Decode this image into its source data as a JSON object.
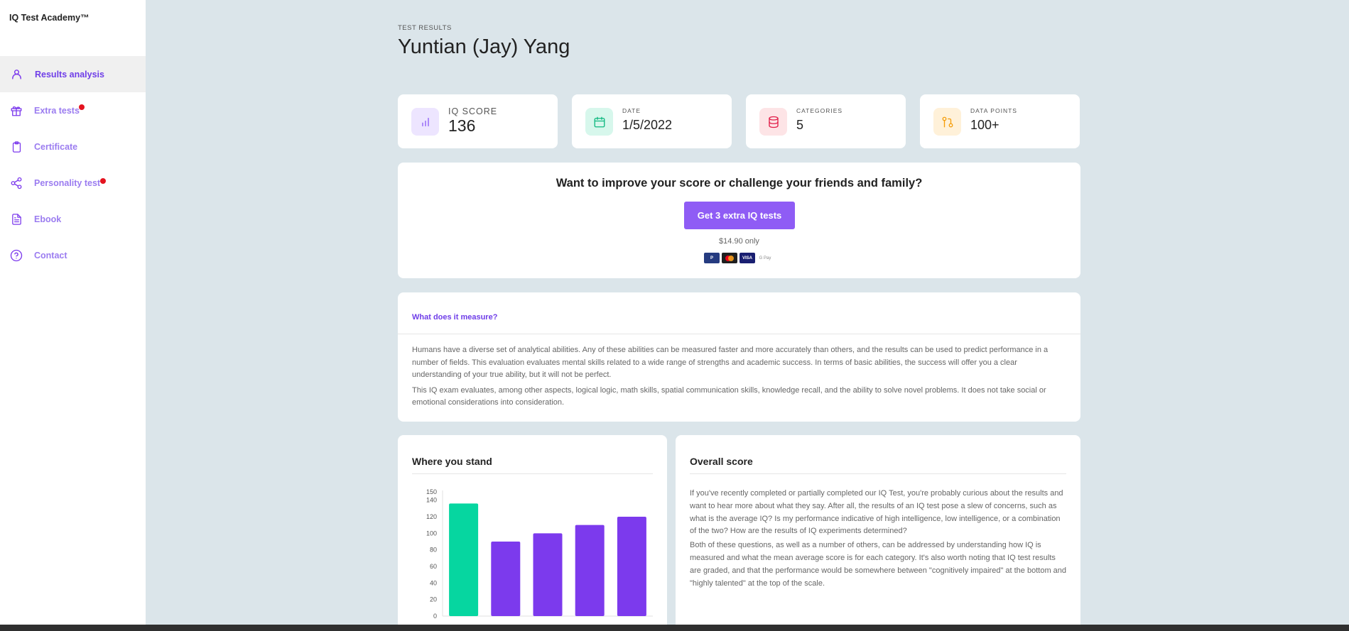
{
  "app": {
    "brand": "IQ Test Academy™"
  },
  "sidebar": {
    "items": [
      {
        "label": "Results analysis",
        "icon": "user-icon",
        "active": true,
        "notification": false
      },
      {
        "label": "Extra tests",
        "icon": "gift-icon",
        "active": false,
        "notification": true
      },
      {
        "label": "Certificate",
        "icon": "clipboard-icon",
        "active": false,
        "notification": false
      },
      {
        "label": "Personality test",
        "icon": "share-icon",
        "active": false,
        "notification": true
      },
      {
        "label": "Ebook",
        "icon": "document-icon",
        "active": false,
        "notification": false
      },
      {
        "label": "Contact",
        "icon": "help-circle-icon",
        "active": false,
        "notification": false
      }
    ]
  },
  "header": {
    "eyebrow": "TEST RESULTS",
    "name": "Yuntian (Jay) Yang"
  },
  "stats": [
    {
      "label": "IQ SCORE",
      "value": "136",
      "icon": "bar-chart-icon",
      "color": "#8b5cf6"
    },
    {
      "label": "DATE",
      "value": "1/5/2022",
      "icon": "calendar-icon",
      "color": "#10b981"
    },
    {
      "label": "CATEGORIES",
      "value": "5",
      "icon": "database-icon",
      "color": "#e11d48"
    },
    {
      "label": "DATA POINTS",
      "value": "100+",
      "icon": "git-pull-icon",
      "color": "#f59e0b"
    }
  ],
  "promo": {
    "title": "Want to improve your score or challenge your friends and family?",
    "button": "Get 3 extra IQ tests",
    "price": "$14.90 only",
    "payments": [
      "PayPal",
      "Mastercard",
      "VISA",
      "G Pay"
    ]
  },
  "measure": {
    "title": "What does it measure?",
    "paragraphs": [
      "Humans have a diverse set of analytical abilities. Any of these abilities can be measured faster and more accurately than others, and the results can be used to predict performance in a number of fields. This evaluation evaluates mental skills related to a wide range of strengths and academic success. In terms of basic abilities, the success will offer you a clear understanding of your true ability, but it will not be perfect.",
      "This IQ exam evaluates, among other aspects, logical logic, math skills, spatial communication skills, knowledge recall, and the ability to solve novel problems. It does not take social or emotional considerations into consideration."
    ]
  },
  "stand": {
    "title": "Where you stand"
  },
  "overall": {
    "title": "Overall score",
    "paragraphs": [
      "If you've recently completed or partially completed our IQ Test, you're probably curious about the results and want to hear more about what they say. After all, the results of an IQ test pose a slew of concerns, such as what is the average IQ? Is my performance indicative of high intelligence, low intelligence, or a combination of the two? How are the results of IQ experiments determined?",
      "Both of these questions, as well as a number of others, can be addressed by understanding how IQ is measured and what the mean average score is for each category. It's also worth noting that IQ test results are graded, and that the performance would be somewhere between \"cognitively impaired\" at the bottom and \"highly talented\" at the top of the scale."
    ]
  },
  "colors": {
    "accent": "#7c3aed",
    "highlight": "#06d6a0",
    "button": "#8f5cf5"
  },
  "chart_data": {
    "type": "bar",
    "title": "",
    "xlabel": "",
    "ylabel": "",
    "categories": [
      "",
      "",
      "",
      "",
      ""
    ],
    "values": [
      136,
      90,
      100,
      110,
      120
    ],
    "bar_colors": [
      "#06d6a0",
      "#7c3aed",
      "#7c3aed",
      "#7c3aed",
      "#7c3aed"
    ],
    "yticks": [
      0,
      20,
      40,
      60,
      80,
      100,
      120,
      140,
      150
    ],
    "ylim": [
      0,
      150
    ],
    "grid": false
  }
}
